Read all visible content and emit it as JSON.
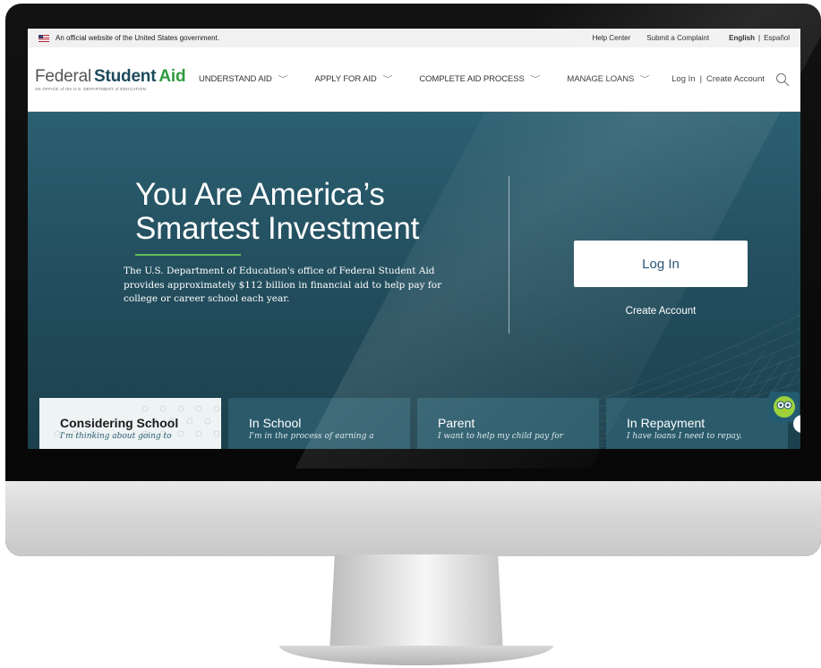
{
  "gov_banner": {
    "official_text": "An official website of the United States government.",
    "help_center": "Help Center",
    "submit_complaint": "Submit a Complaint",
    "lang_english": "English",
    "lang_separator": "|",
    "lang_spanish": "Español"
  },
  "logo": {
    "word_federal": "Federal",
    "word_student": "Student",
    "word_aid": "Aid",
    "subtitle": "AN OFFICE of the U.S. DEPARTMENT of EDUCATION"
  },
  "nav": {
    "items": [
      {
        "label": "UNDERSTAND AID"
      },
      {
        "label": "APPLY FOR AID"
      },
      {
        "label": "COMPLETE AID PROCESS"
      },
      {
        "label": "MANAGE LOANS"
      }
    ],
    "login": "Log In",
    "separator": "|",
    "create_account": "Create Account",
    "search_icon": "search-icon"
  },
  "hero": {
    "title_line1": "You Are America’s",
    "title_line2": "Smartest Investment",
    "description": "The U.S. Department of Education's office of Federal Student Aid provides approximately $112 billion in financial aid to help pay for college or career school each year.",
    "login_button": "Log In",
    "create_account": "Create Account"
  },
  "cards": [
    {
      "title": "Considering School",
      "subtitle": "I'm thinking about going to"
    },
    {
      "title": "In School",
      "subtitle": "I'm in the process of earning a"
    },
    {
      "title": "Parent",
      "subtitle": "I want to help my child pay for"
    },
    {
      "title": "In Repayment",
      "subtitle": "I have loans I need to repay."
    }
  ],
  "colors": {
    "hero_bg": "#234f5f",
    "brand_blue": "#1d4b5c",
    "brand_green": "#2f9b3f",
    "card_dark": "#2b5b6b"
  },
  "icons": {
    "flag": "us-flag-icon",
    "chevron": "chevron-down-icon",
    "chat": "owl-chat-icon"
  }
}
